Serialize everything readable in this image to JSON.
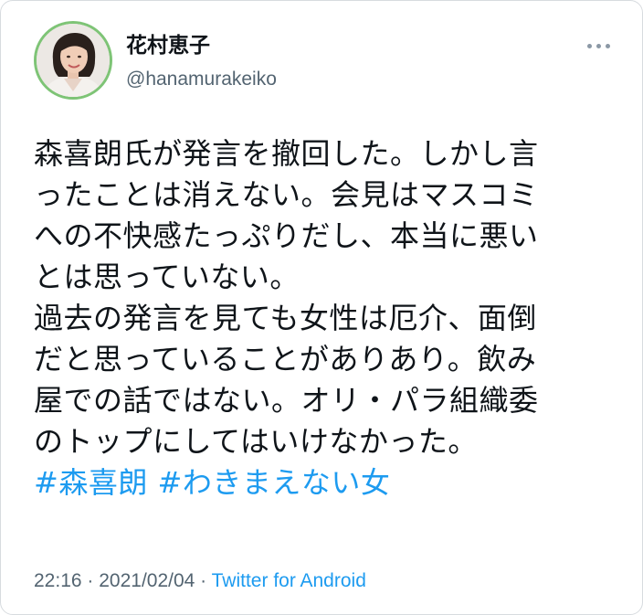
{
  "author": {
    "display_name": "花村恵子",
    "handle": "@hanamurakeiko",
    "avatar_icon": "profile-photo",
    "avatar_ring_color": "#7ec476"
  },
  "more_icon": "more-dots-icon",
  "tweet": {
    "lines": [
      "森喜朗氏が発言を撤回した。しかし言",
      "ったことは消えない。会見はマスコミ",
      "への不快感たっぷりだし、本当に悪い",
      "とは思っていない。",
      "過去の発言を見ても女性は厄介、面倒",
      "だと思っていることがありあり。飲み",
      "屋での話ではない。オリ・パラ組織委",
      "のトップにしてはいけなかった。"
    ],
    "hashtags": [
      "#森喜朗",
      "#わきまえない女"
    ],
    "hashtag_color": "#1d9bf0"
  },
  "meta": {
    "time": "22:16",
    "separator": " · ",
    "date": "2021/02/04",
    "source": "Twitter for Android"
  }
}
